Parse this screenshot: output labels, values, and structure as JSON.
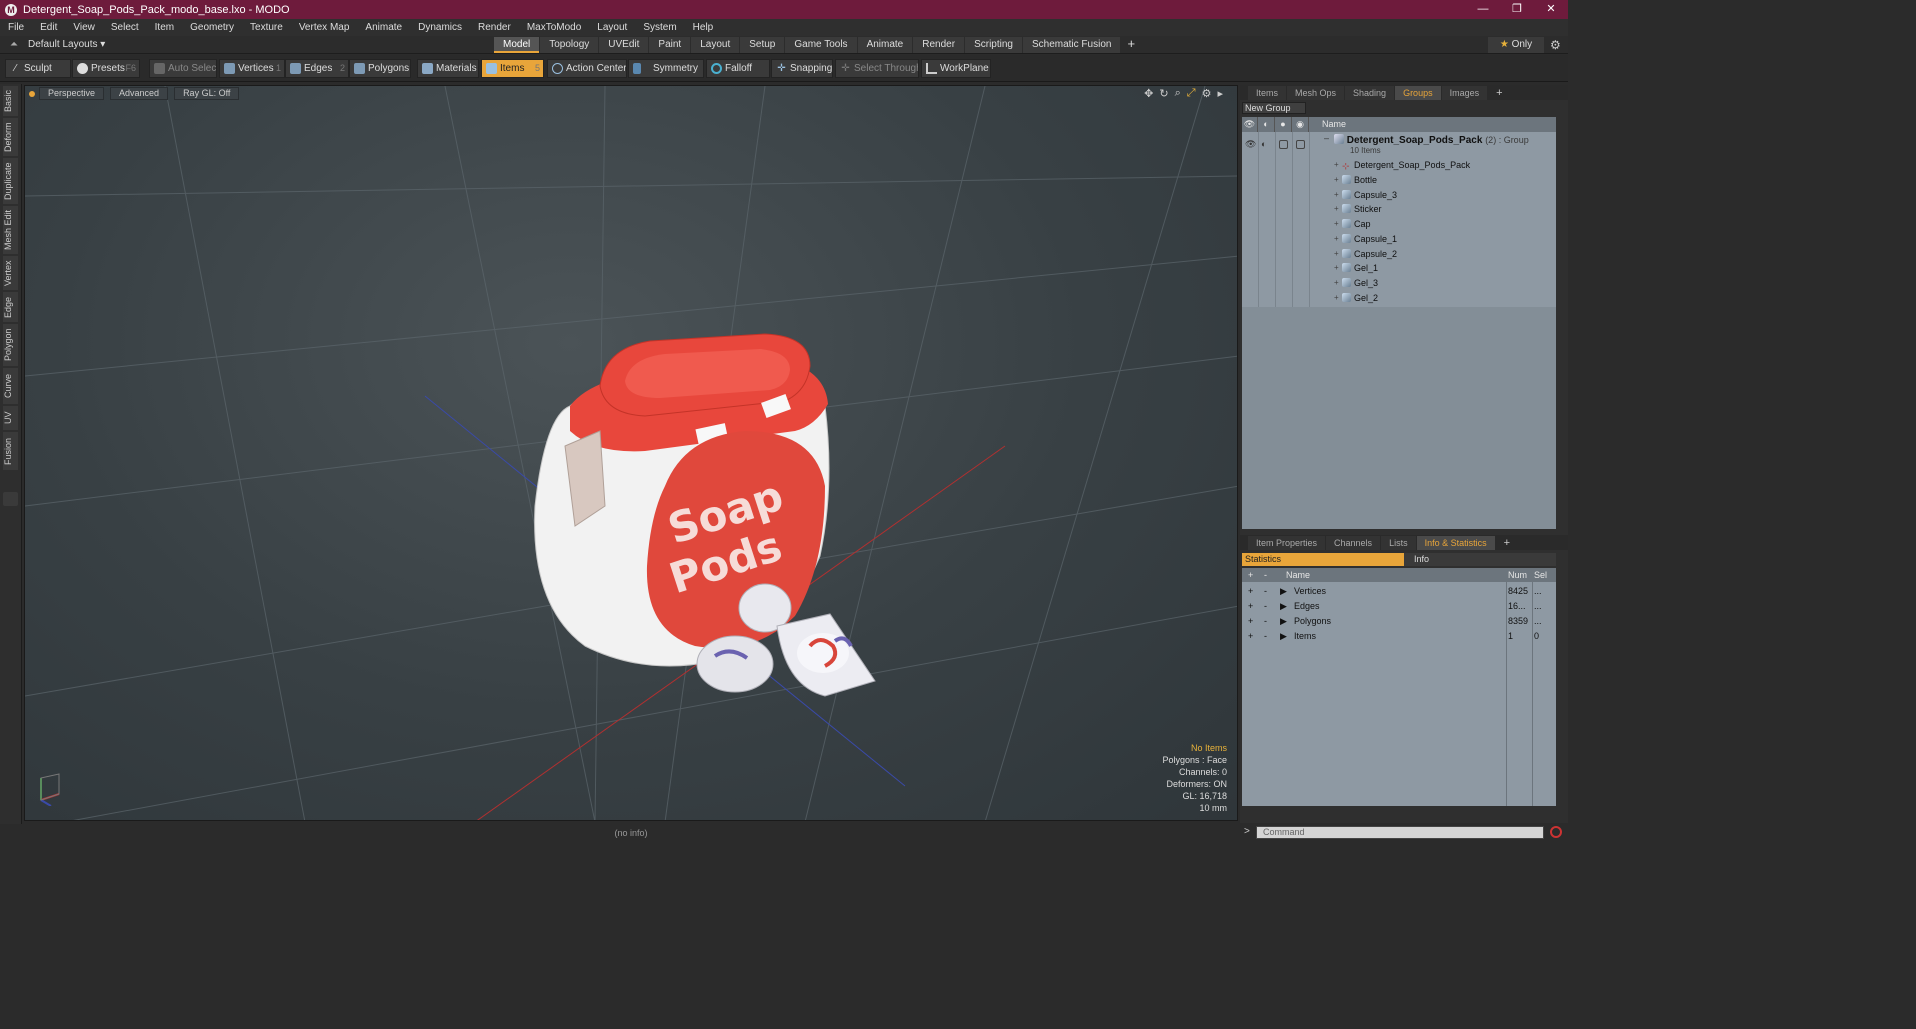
{
  "window": {
    "title": "Detergent_Soap_Pods_Pack_modo_base.lxo - MODO",
    "min": "—",
    "max": "❐",
    "close": "✕"
  },
  "menu": [
    "File",
    "Edit",
    "View",
    "Select",
    "Item",
    "Geometry",
    "Texture",
    "Vertex Map",
    "Animate",
    "Dynamics",
    "Render",
    "MaxToModo",
    "Layout",
    "System",
    "Help"
  ],
  "layout_selector": "Default Layouts ▾",
  "layout_tabs": [
    "Model",
    "Topology",
    "UVEdit",
    "Paint",
    "Layout",
    "Setup",
    "Game Tools",
    "Animate",
    "Render",
    "Scripting",
    "Schematic Fusion"
  ],
  "active_layout_tab": "Model",
  "only_label": "Only",
  "toolbar": {
    "sculpt": "Sculpt",
    "presets": "Presets",
    "presets_key": "F6",
    "auto_select": "Auto Select",
    "vertices": "Vertices",
    "vertices_key": "1",
    "edges": "Edges",
    "edges_key": "2",
    "polygons": "Polygons",
    "materials": "Materials",
    "items": "Items",
    "items_key": "5",
    "action_center": "Action Center",
    "symmetry": "Symmetry",
    "falloff": "Falloff",
    "snapping": "Snapping",
    "select_through": "Select Through",
    "workplane": "WorkPlane"
  },
  "left_tabs": [
    "Basic",
    "Deform",
    "Duplicate",
    "Mesh Edit",
    "Vertex",
    "Edge",
    "Polygon",
    "Curve",
    "UV",
    "Fusion"
  ],
  "viewport": {
    "view": "Perspective",
    "shading": "Advanced",
    "raygl": "Ray GL: Off",
    "label_text": "Soap Pods",
    "stats": {
      "selection": "No Items",
      "polygons": "Polygons : Face",
      "channels": "Channels: 0",
      "deformers": "Deformers: ON",
      "gl": "GL: 16,718",
      "size": "10 mm"
    }
  },
  "groups_panel": {
    "tabs": [
      "Items",
      "Mesh Ops",
      "Shading",
      "Groups",
      "Images"
    ],
    "active_tab": "Groups",
    "new_group": "New Group",
    "name_header": "Name",
    "group_name": "Detergent_Soap_Pods_Pack",
    "group_suffix": "(2) : Group",
    "group_count": "10 Items",
    "children": [
      "Detergent_Soap_Pods_Pack",
      "Bottle",
      "Capsule_3",
      "Sticker",
      "Cap",
      "Capsule_1",
      "Capsule_2",
      "Gel_1",
      "Gel_3",
      "Gel_2"
    ]
  },
  "stats_panel": {
    "tabs": [
      "Item Properties",
      "Channels",
      "Lists",
      "Info & Statistics"
    ],
    "active_tab": "Info & Statistics",
    "subtab_statistics": "Statistics",
    "subtab_info": "Info",
    "headers": {
      "name": "Name",
      "num": "Num",
      "sel": "Sel"
    },
    "rows": [
      {
        "name": "Vertices",
        "num": "8425",
        "sel": "..."
      },
      {
        "name": "Edges",
        "num": "16...",
        "sel": "..."
      },
      {
        "name": "Polygons",
        "num": "8359",
        "sel": "..."
      },
      {
        "name": "Items",
        "num": "1",
        "sel": "0"
      }
    ]
  },
  "status": "(no info)",
  "command_placeholder": "Command",
  "colors": {
    "accent": "#e8a53a",
    "titlebar": "#6e1b3c",
    "cap_red": "#e8473c"
  }
}
